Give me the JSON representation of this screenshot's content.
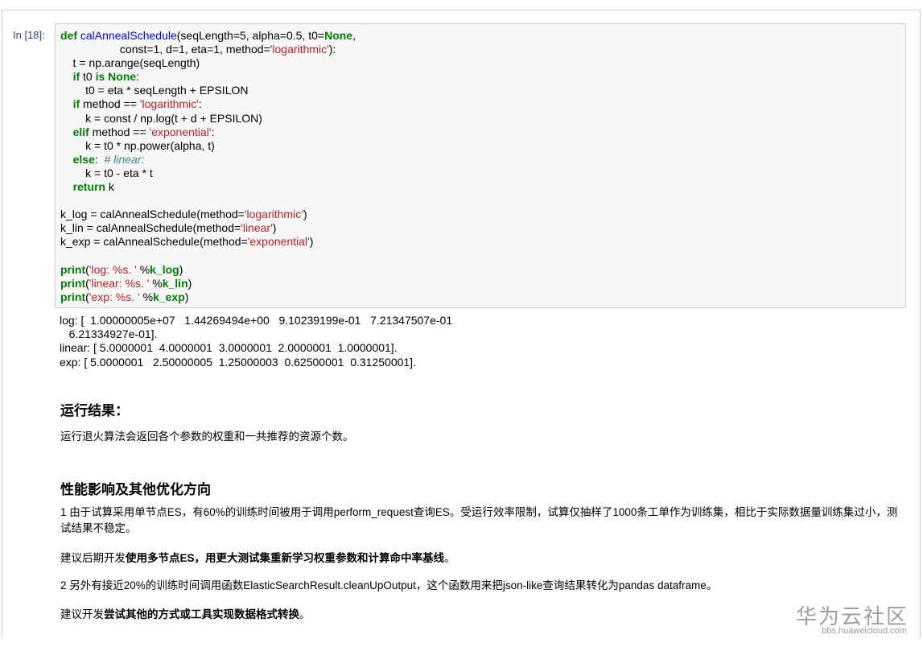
{
  "cell": {
    "prompt": "In [18]:",
    "code_lines": [
      [
        [
          "def",
          "kw"
        ],
        [
          " ",
          ""
        ],
        [
          "calAnnealSchedule",
          "def"
        ],
        [
          "(seqLength=5, alpha=0.5, t0=",
          ""
        ],
        [
          "None",
          "kw"
        ],
        [
          ",",
          ""
        ]
      ],
      [
        [
          "                   const=1, d=1, eta=1, method=",
          ""
        ],
        [
          "'logarithmic'",
          "str"
        ],
        [
          "):",
          ""
        ]
      ],
      [
        [
          "    t = np.arange(seqLength)",
          ""
        ]
      ],
      [
        [
          "    ",
          ""
        ],
        [
          "if",
          "kw"
        ],
        [
          " t0 ",
          ""
        ],
        [
          "is",
          "kw"
        ],
        [
          " ",
          ""
        ],
        [
          "None",
          "kw"
        ],
        [
          ":",
          ""
        ]
      ],
      [
        [
          "        t0 = eta * seqLength + EPSILON",
          ""
        ]
      ],
      [
        [
          "    ",
          ""
        ],
        [
          "if",
          "kw"
        ],
        [
          " method == ",
          ""
        ],
        [
          "'logarithmic'",
          "str"
        ],
        [
          ":",
          ""
        ]
      ],
      [
        [
          "        k = const / np.log(t + d + EPSILON)",
          ""
        ]
      ],
      [
        [
          "    ",
          ""
        ],
        [
          "elif",
          "kw"
        ],
        [
          " method == ",
          ""
        ],
        [
          "'exponential'",
          "str"
        ],
        [
          ":",
          ""
        ]
      ],
      [
        [
          "        k = t0 * np.power(alpha, t)",
          ""
        ]
      ],
      [
        [
          "    ",
          ""
        ],
        [
          "else",
          "kw"
        ],
        [
          ":  ",
          ""
        ],
        [
          "# linear:",
          "cm"
        ]
      ],
      [
        [
          "        k = t0 - eta * t",
          ""
        ]
      ],
      [
        [
          "    ",
          ""
        ],
        [
          "return",
          "kw"
        ],
        [
          " k",
          ""
        ]
      ],
      [
        [
          "",
          ""
        ]
      ],
      [
        [
          "k_log = calAnnealSchedule(method=",
          ""
        ],
        [
          "'logarithmic'",
          "str"
        ],
        [
          ")",
          ""
        ]
      ],
      [
        [
          "k_lin = calAnnealSchedule(method=",
          ""
        ],
        [
          "'linear'",
          "str"
        ],
        [
          ")",
          ""
        ]
      ],
      [
        [
          "k_exp = calAnnealSchedule(method=",
          ""
        ],
        [
          "'exponential'",
          "str"
        ],
        [
          ")",
          ""
        ]
      ],
      [
        [
          "",
          ""
        ]
      ],
      [
        [
          "print",
          "kw"
        ],
        [
          "(",
          ""
        ],
        [
          "'log: %s. '",
          "str"
        ],
        [
          " %",
          ""
        ],
        [
          "k_log",
          "kw"
        ],
        [
          ")",
          ""
        ]
      ],
      [
        [
          "print",
          "kw"
        ],
        [
          "(",
          ""
        ],
        [
          "'linear: %s. '",
          "str"
        ],
        [
          " %",
          ""
        ],
        [
          "k_lin",
          "kw"
        ],
        [
          ")",
          ""
        ]
      ],
      [
        [
          "print",
          "kw"
        ],
        [
          "(",
          ""
        ],
        [
          "'exp: %s. '",
          "str"
        ],
        [
          " %",
          ""
        ],
        [
          "k_exp",
          "kw"
        ],
        [
          ")",
          ""
        ]
      ]
    ],
    "output": "log: [  1.00000005e+07   1.44269494e+00   9.10239199e-01   7.21347507e-01\n   6.21334927e-01].\nlinear: [ 5.0000001  4.0000001  3.0000001  2.0000001  1.0000001].\nexp: [ 5.0000001   2.50000005  1.25000003  0.62500001  0.31250001]."
  },
  "markdown": {
    "h1": "运行结果：",
    "p1": "运行退火算法会返回各个参数的权重和一共推荐的资源个数。",
    "h2": "性能影响及其他优化方向",
    "p2": "1 由于试算采用单节点ES，有60%的训练时间被用于调用perform_request查询ES。受运行效率限制，试算仅抽样了1000条工单作为训练集，相比于实际数据量训练集过小，测试结果不稳定。",
    "p3_prefix": "建议后期开发",
    "p3_bold": "使用多节点ES，用更大测试集重新学习权重参数和计算命中率基线",
    "p3_suffix": "。",
    "p4": "2 另外有接近20%的训练时间调用函数ElasticSearchResult.cleanUpOutput，这个函数用来把json-like查询结果转化为pandas dataframe。",
    "p5_prefix": "建议开发",
    "p5_bold": "尝试其他的方式或工具实现数据格式转换",
    "p5_suffix": "。"
  },
  "watermark": {
    "brand": "华为云社区",
    "url": "bbs.huaweicloud.com"
  }
}
